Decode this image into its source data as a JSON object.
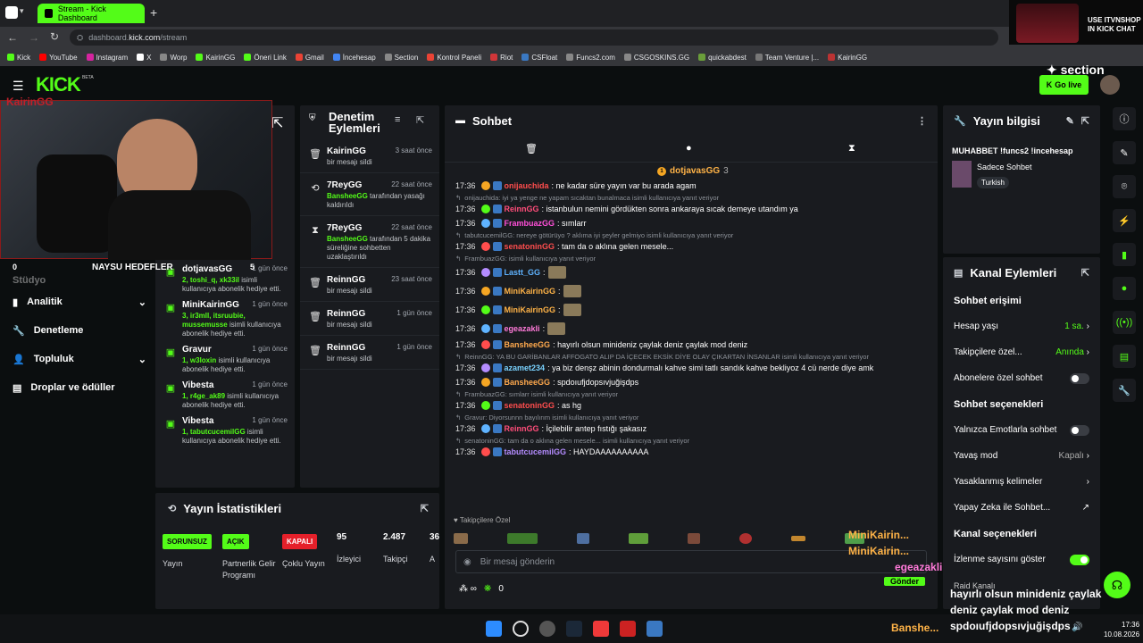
{
  "browser": {
    "tab_title": "Stream - Kick Dashboard",
    "url_prefix": "dashboard.",
    "url_host": "kick.com",
    "url_path": "/stream"
  },
  "bookmarks": [
    "Kick",
    "YouTube",
    "Instagram",
    "X",
    "Worp",
    "KairinGG",
    "Öneri Link",
    "Gmail",
    "İncehesap",
    "Section",
    "Kontrol Paneli",
    "Riot",
    "CSFloat",
    "Funcs2.com",
    "CSGOSKINS.GG",
    "quickabdest",
    "Team Venture |...",
    "KairinGG"
  ],
  "ad": {
    "line1": "USE ITVNSHOP",
    "line2": "IN KICK CHAT"
  },
  "topnav": {
    "logo": "KICK",
    "beta": "BETA",
    "go_live": "Go live",
    "sponsor": "section"
  },
  "webcam": {
    "overlay_name": "KairinGG",
    "goal_label": "NAYSU HEDEFLER",
    "goal_left": "0",
    "goal_right": "5"
  },
  "sidebar": {
    "items": [
      {
        "label": "Stüdyo"
      },
      {
        "label": "Analitik"
      },
      {
        "label": "Denetleme"
      },
      {
        "label": "Topluluk"
      },
      {
        "label": "Droplar ve ödüller"
      }
    ]
  },
  "events": [
    {
      "name": "dotjavasGG",
      "time": "1 gün önce",
      "highlight": "2, toshi_q, xk33il",
      "desc": "isimli kullanıcıya abonelik hediye etti."
    },
    {
      "name": "MiniKairinGG",
      "time": "1 gün önce",
      "highlight": "3, ir3mll, itsruubie, mussemusse",
      "desc": "isimli kullanıcıya abonelik hediye etti."
    },
    {
      "name": "Gravur",
      "time": "1 gün önce",
      "highlight": "1, w3loxin",
      "desc": "isimli kullanıcıya abonelik hediye etti."
    },
    {
      "name": "Vibesta",
      "time": "1 gün önce",
      "highlight": "1, r4ge_ak89",
      "desc": "isimli kullanıcıya abonelik hediye etti."
    },
    {
      "name": "Vibesta",
      "time": "1 gün önce",
      "highlight": "1, tabutcucemilGG",
      "desc": "isimli kullanıcıya abonelik hediye etti."
    }
  ],
  "moderation": {
    "title_line1": "Denetim",
    "title_line2": "Eylemleri",
    "items": [
      {
        "name": "KairinGG",
        "time": "3 saat önce",
        "desc": "bir mesajı sildi",
        "icon": "trash-icon",
        "hl": ""
      },
      {
        "name": "7ReyGG",
        "time": "22 saat önce",
        "desc": "tarafından yasağı kaldırıldı",
        "icon": "unban-icon",
        "hl": "BansheeGG"
      },
      {
        "name": "7ReyGG",
        "time": "22 saat önce",
        "desc": "tarafından 5 dakika süreliğine sohbetten uzaklaştırıldı",
        "icon": "hourglass-icon",
        "hl": "BansheeGG"
      },
      {
        "name": "ReinnGG",
        "time": "23 saat önce",
        "desc": "bir mesajı sildi",
        "icon": "trash-icon",
        "hl": ""
      },
      {
        "name": "ReinnGG",
        "time": "1 gün önce",
        "desc": "bir mesajı sildi",
        "icon": "trash-icon",
        "hl": ""
      },
      {
        "name": "ReinnGG",
        "time": "1 gün önce",
        "desc": "bir mesajı sildi",
        "icon": "trash-icon",
        "hl": ""
      }
    ]
  },
  "chat": {
    "title": "Sohbet",
    "pinned_user": "dotjavasGG",
    "pinned_count": "3",
    "input_placeholder": "Bir mesaj gönderin",
    "followers_label": "Takipçilere Özel",
    "send": "Gönder",
    "points": "0",
    "lines": [
      {
        "reply": "",
        "time": "17:36",
        "user": "onijauchida",
        "color": "#ff4d4d",
        "msg": ": ne kadar süre yayın var bu arada agam"
      },
      {
        "reply": "onijauchida: iyi ya yenge ne yapam sıcaktan bunalmaca isimli kullanıcıya yanıt veriyor",
        "time": "17:36",
        "user": "ReinnGG",
        "color": "#ff4d7a",
        "msg": ": istanbulun nemini gördükten sonra ankaraya sıcak demeye utandım ya"
      },
      {
        "reply": "",
        "time": "17:36",
        "user": "FrambuazGG",
        "color": "#ff4fd8",
        "msg": ": sımlarr"
      },
      {
        "reply": "tabutcucemilGG: nereye götürüyo ? aklıma iyi şeyler gelmiyo isimli kullanıcıya yanıt veriyor",
        "time": "17:36",
        "user": "senatoninGG",
        "color": "#ff4d4d",
        "msg": ": tam da o aklına gelen mesele..."
      },
      {
        "reply": "FrambuazGG: isimli kullanıcıya yanıt veriyor",
        "time": "17:36",
        "user": "Lastt_GG",
        "color": "#5fb3ff",
        "msg": ":"
      },
      {
        "reply": "",
        "time": "17:36",
        "user": "MiniKairinGG",
        "color": "#ffb347",
        "msg": ":"
      },
      {
        "reply": "",
        "time": "17:36",
        "user": "MiniKairinGG",
        "color": "#ffb347",
        "msg": ":"
      },
      {
        "reply": "",
        "time": "17:36",
        "user": "egeazakli",
        "color": "#ff7ad9",
        "msg": ":"
      },
      {
        "reply": "",
        "time": "17:36",
        "user": "BansheeGG",
        "color": "#ffa94d",
        "msg": ": hayırlı olsun minideniz çaylak deniz çaylak mod deniz"
      },
      {
        "reply": "ReinnGG: YA BU GARİBANLAR AFFOGATO ALIP DA İÇECEK EKSİK DİYE OLAY ÇIKARTAN İNSANLAR isimli kullanıcıya yanıt veriyor",
        "time": "17:36",
        "user": "azamet234",
        "color": "#7ad3ff",
        "msg": ": ya biz denşz abinin dondurmalı kahve simi tatlı sandık kahve bekliyoz 4 cü nerde diye amk"
      },
      {
        "reply": "",
        "time": "17:36",
        "user": "BansheeGG",
        "color": "#ffa94d",
        "msg": ": spdoıufjdopsıvjuğişdps"
      },
      {
        "reply": "FrambuazGG: sımlarr isimli kullanıcıya yanıt veriyor",
        "time": "17:36",
        "user": "senatoninGG",
        "color": "#ff4d4d",
        "msg": ": as hg"
      },
      {
        "reply": "Gravur: Diyorsunnn bayılırım isimli kullanıcıya yanıt veriyor",
        "time": "17:36",
        "user": "ReinnGG",
        "color": "#ff4d7a",
        "msg": ": İçilebilir antep fıstığı şakasız"
      },
      {
        "reply": "senatoninGG: tam da o aklına gelen mesele... isimli kullanıcıya yanıt veriyor",
        "time": "17:36",
        "user": "tabutcucemilGG",
        "color": "#b48cff",
        "msg": ": HAYDAAAAAAAAAA"
      }
    ]
  },
  "stream_info": {
    "title": "Yayın bilgisi",
    "stream_title": "MUHABBET !funcs2 !incehesap",
    "category": "Sadece Sohbet",
    "language": "Turkish"
  },
  "channel_actions": {
    "title": "Kanal Eylemleri",
    "chat_access": "Sohbet erişimi",
    "account_age": "Hesap yaşı",
    "account_age_val": "1 sa.",
    "followers_only": "Takipçilere özel...",
    "followers_only_val": "Anında",
    "subs_only": "Abonelere özel sohbet",
    "chat_options": "Sohbet seçenekleri",
    "emote_only": "Yalnızca Emotlarla sohbet",
    "slow_mode": "Yavaş mod",
    "slow_mode_val": "Kapalı",
    "banned_words": "Yasaklanmış kelimeler",
    "ai_chat": "Yapay Zeka ile Sohbet...",
    "channel_options": "Kanal seçenekleri",
    "show_count": "İzlenme sayısını göster",
    "raid": "Raid Kanalı"
  },
  "stats": {
    "title": "Yayın İstatistikleri",
    "pills": [
      {
        "label": "SORUNSUZ",
        "bg": "#53fc18",
        "fg": "#0b0e0f"
      },
      {
        "label": "AÇIK",
        "bg": "#53fc18",
        "fg": "#0b0e0f"
      },
      {
        "label": "KAPALI",
        "bg": "#e5202a",
        "fg": "#fff"
      }
    ],
    "pill_captions": [
      "Yayın",
      "Partnerlik Gelir Programı",
      "Çoklu Yayın"
    ],
    "numbers": [
      {
        "value": "95",
        "label": "İzleyici"
      },
      {
        "value": "2.487",
        "label": "Takipçi"
      },
      {
        "value": "36",
        "label": "A"
      }
    ]
  },
  "overlay_chat": [
    "MiniKairin...",
    "MiniKairin...",
    "egeazakli",
    "Gönder",
    "hayırlı olsun minideniz çaylak",
    "deniz çaylak mod deniz",
    "spdoıufjdopsıvjuğişdps",
    "Banshe..."
  ],
  "clock": {
    "time": "17:36",
    "date": "10.08.2026"
  }
}
